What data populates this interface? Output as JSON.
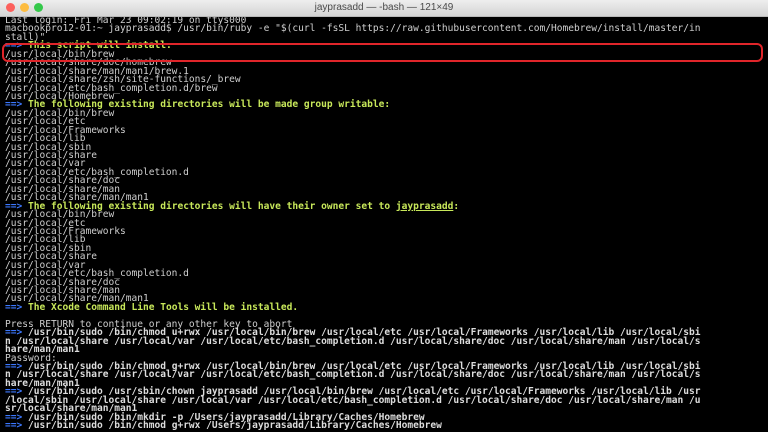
{
  "window": {
    "title": "jayprasadd — -bash — 121×49",
    "traffic_lights": {
      "close": "#fc605c",
      "minimize": "#fdbc40",
      "zoom": "#34c84a"
    },
    "highlight_color": "#e0252a"
  },
  "terminal": {
    "last_login": "Last login: Fri Mar 23 09:02:19 on ttys000",
    "prompt_line_1": "macbookpro12-01:~ jayprasadd$ /usr/bin/ruby -e \"$(curl -fsSL https://raw.githubusercontent.com/Homebrew/install/master/in",
    "prompt_line_2": "stall)\"",
    "arrow": "==>",
    "header_install": "This script will install:",
    "install_paths": [
      "/usr/local/bin/brew",
      "/usr/local/share/doc/homebrew",
      "/usr/local/share/man/man1/brew.1",
      "/usr/local/share/zsh/site-functions/_brew",
      "/usr/local/etc/bash_completion.d/brew",
      "/usr/local/Homebrew"
    ],
    "header_group": "The following existing directories will be made group writable:",
    "group_paths": [
      "/usr/local/bin/brew",
      "/usr/local/etc",
      "/usr/local/Frameworks",
      "/usr/local/lib",
      "/usr/local/sbin",
      "/usr/local/share",
      "/usr/local/var",
      "/usr/local/etc/bash_completion.d",
      "/usr/local/share/doc",
      "/usr/local/share/man",
      "/usr/local/share/man/man1"
    ],
    "header_owner_prefix": "The following existing directories will have their owner set to ",
    "header_owner_user": "jayprasadd",
    "header_owner_suffix": ":",
    "owner_paths": [
      "/usr/local/bin/brew",
      "/usr/local/etc",
      "/usr/local/Frameworks",
      "/usr/local/lib",
      "/usr/local/sbin",
      "/usr/local/share",
      "/usr/local/var",
      "/usr/local/etc/bash_completion.d",
      "/usr/local/share/doc",
      "/usr/local/share/man",
      "/usr/local/share/man/man1"
    ],
    "header_xcode": "The Xcode Command Line Tools will be installed.",
    "press_return": "Press RETURN to continue or any other key to abort",
    "cmd1_line1": "/usr/bin/sudo /bin/chmod u+rwx /usr/local/bin/brew /usr/local/etc /usr/local/Frameworks /usr/local/lib /usr/local/sbi",
    "cmd1_line2": "n /usr/local/share /usr/local/var /usr/local/etc/bash_completion.d /usr/local/share/doc /usr/local/share/man /usr/local/s",
    "cmd1_line3": "hare/man/man1",
    "password": "Password:",
    "cmd2_line1": "/usr/bin/sudo /bin/chmod g+rwx /usr/local/bin/brew /usr/local/etc /usr/local/Frameworks /usr/local/lib /usr/local/sbi",
    "cmd2_line2": "n /usr/local/share /usr/local/var /usr/local/etc/bash_completion.d /usr/local/share/doc /usr/local/share/man /usr/local/s",
    "cmd2_line3": "hare/man/man1",
    "cmd3_line1": "/usr/bin/sudo /usr/sbin/chown jayprasadd /usr/local/bin/brew /usr/local/etc /usr/local/Frameworks /usr/local/lib /usr",
    "cmd3_line2": "/local/sbin /usr/local/share /usr/local/var /usr/local/etc/bash_completion.d /usr/local/share/doc /usr/local/share/man /u",
    "cmd3_line3": "sr/local/share/man/man1",
    "cmd4": "/usr/bin/sudo /bin/mkdir -p /Users/jayprasadd/Library/Caches/Homebrew",
    "cmd5": "/usr/bin/sudo /bin/chmod g+rwx /Users/jayprasadd/Library/Caches/Homebrew"
  }
}
